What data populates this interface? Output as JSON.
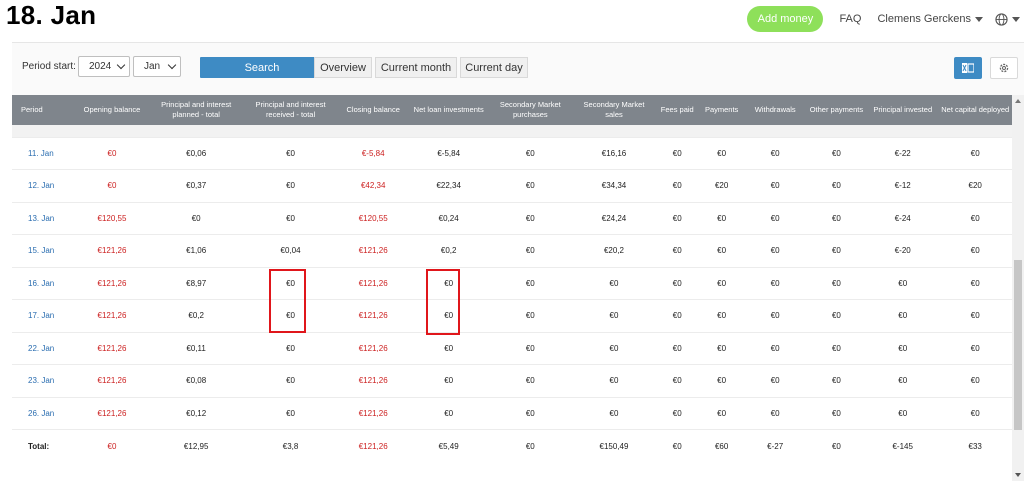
{
  "title": "18. Jan",
  "topnav": {
    "add_money": "Add money",
    "faq": "FAQ",
    "user": "Clemens Gerckens",
    "user_icon": "chevron-down-icon",
    "globe_icon": "globe-icon"
  },
  "filters": {
    "period_label": "Period start:",
    "year": "2024",
    "month": "Jan",
    "search": "Search",
    "tabs": [
      "Overview",
      "Current month",
      "Current day"
    ],
    "excel_icon": "excel-export-icon",
    "settings_icon": "gear-icon"
  },
  "colors": {
    "accent_blue": "#3e8bc4",
    "add_money_green": "#8ee05a",
    "header_gray": "#7f858c",
    "negative_red": "#cc1f1f",
    "highlight_red": "#e0161b",
    "period_link": "#2a6db0"
  },
  "table": {
    "headers": [
      "Period",
      "Opening balance",
      "Principal and interest planned - total",
      "Principal and interest received - total",
      "Closing balance",
      "Net loan investments",
      "Secondary Market purchases",
      "Secondary Market sales",
      "Fees paid",
      "Payments",
      "Withdrawals",
      "Other payments",
      "Principal invested",
      "Net capital deployed"
    ],
    "rows": [
      [
        "11. Jan",
        "€0",
        "€0,06",
        "€0",
        "€-5,84",
        "€-5,84",
        "€0",
        "€16,16",
        "€0",
        "€0",
        "€0",
        "€0",
        "€-22",
        "€0"
      ],
      [
        "12. Jan",
        "€0",
        "€0,37",
        "€0",
        "€42,34",
        "€22,34",
        "€0",
        "€34,34",
        "€0",
        "€20",
        "€0",
        "€0",
        "€-12",
        "€20"
      ],
      [
        "13. Jan",
        "€120,55",
        "€0",
        "€0",
        "€120,55",
        "€0,24",
        "€0",
        "€24,24",
        "€0",
        "€0",
        "€0",
        "€0",
        "€-24",
        "€0"
      ],
      [
        "15. Jan",
        "€121,26",
        "€1,06",
        "€0,04",
        "€121,26",
        "€0,2",
        "€0",
        "€20,2",
        "€0",
        "€0",
        "€0",
        "€0",
        "€-20",
        "€0"
      ],
      [
        "16. Jan",
        "€121,26",
        "€8,97",
        "€0",
        "€121,26",
        "€0",
        "€0",
        "€0",
        "€0",
        "€0",
        "€0",
        "€0",
        "€0",
        "€0"
      ],
      [
        "17. Jan",
        "€121,26",
        "€0,2",
        "€0",
        "€121,26",
        "€0",
        "€0",
        "€0",
        "€0",
        "€0",
        "€0",
        "€0",
        "€0",
        "€0"
      ],
      [
        "22. Jan",
        "€121,26",
        "€0,11",
        "€0",
        "€121,26",
        "€0",
        "€0",
        "€0",
        "€0",
        "€0",
        "€0",
        "€0",
        "€0",
        "€0"
      ],
      [
        "23. Jan",
        "€121,26",
        "€0,08",
        "€0",
        "€121,26",
        "€0",
        "€0",
        "€0",
        "€0",
        "€0",
        "€0",
        "€0",
        "€0",
        "€0"
      ],
      [
        "26. Jan",
        "€121,26",
        "€0,12",
        "€0",
        "€121,26",
        "€0",
        "€0",
        "€0",
        "€0",
        "€0",
        "€0",
        "€0",
        "€0",
        "€0"
      ]
    ],
    "total": [
      "Total:",
      "€0",
      "€12,95",
      "€3,8",
      "€121,26",
      "€5,49",
      "€0",
      "€150,49",
      "€0",
      "€60",
      "€-27",
      "€0",
      "€-145",
      "€33"
    ]
  }
}
